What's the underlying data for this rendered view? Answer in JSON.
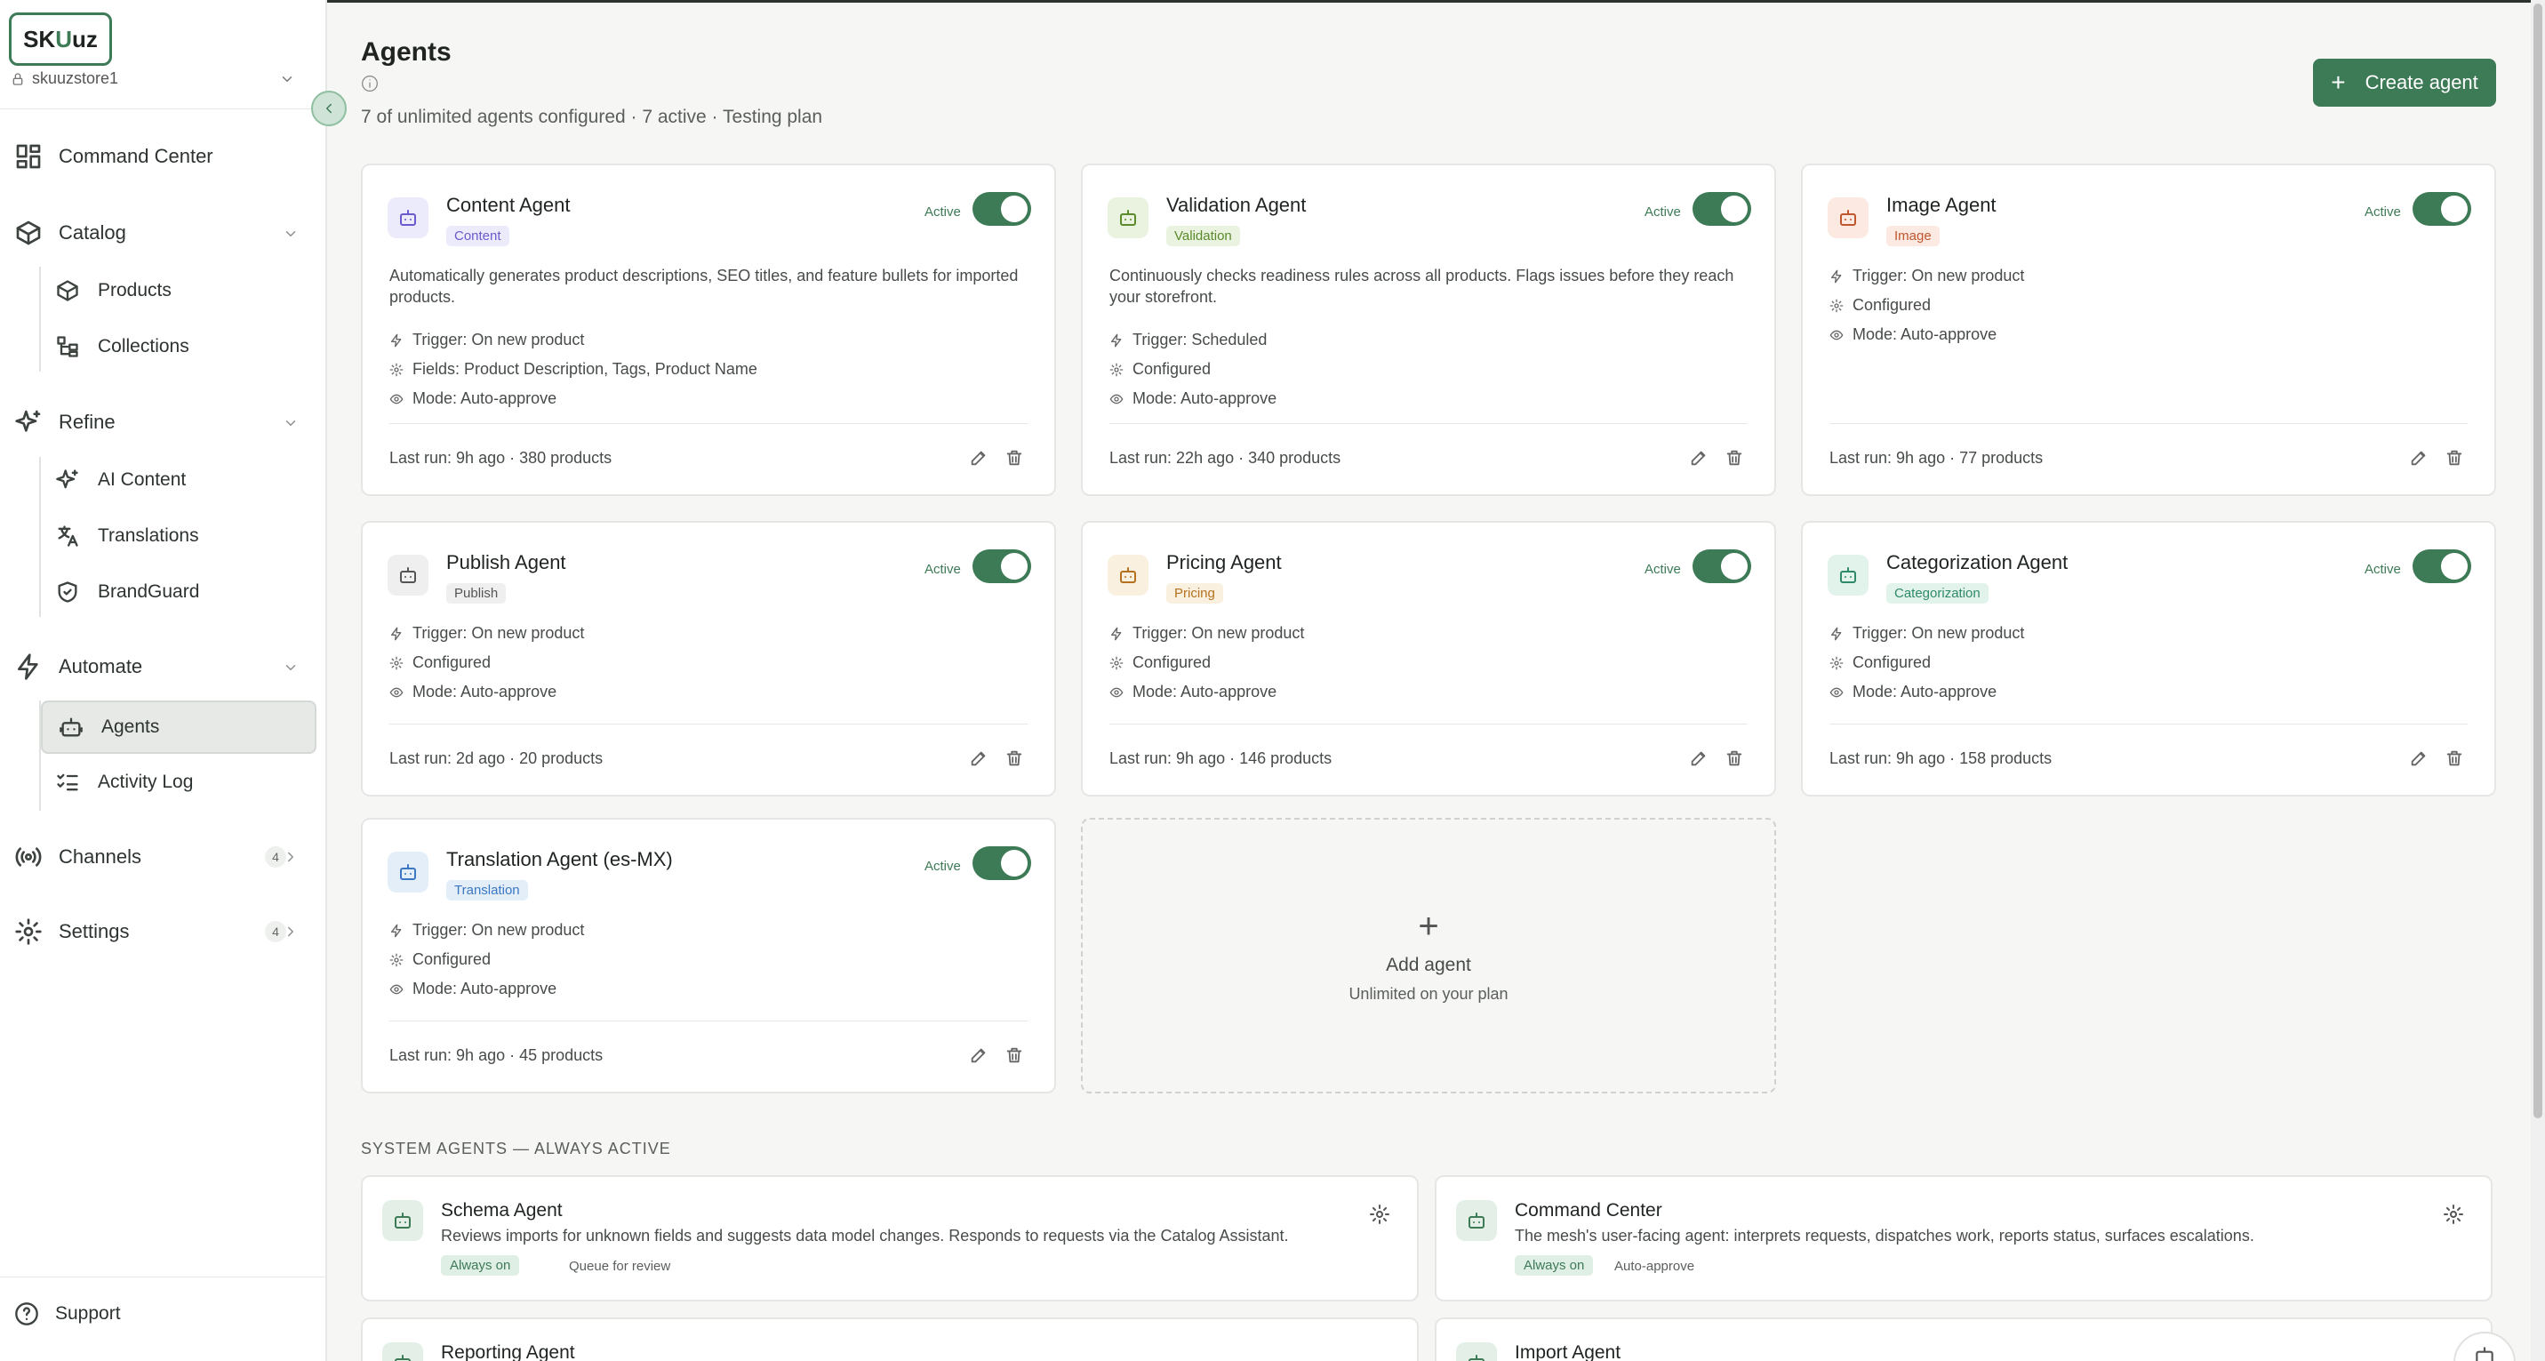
{
  "brand": {
    "logo_a": "SK",
    "logo_b": "U",
    "logo_c": "uz",
    "store": "skuuzstore1"
  },
  "nav": {
    "command_center": "Command Center",
    "catalog": "Catalog",
    "products": "Products",
    "collections": "Collections",
    "refine": "Refine",
    "ai_content": "AI Content",
    "translations": "Translations",
    "brandguard": "BrandGuard",
    "automate": "Automate",
    "agents": "Agents",
    "activity_log": "Activity Log",
    "channels": "Channels",
    "channels_count": "4",
    "settings": "Settings",
    "settings_count": "4",
    "support": "Support"
  },
  "header": {
    "title": "Agents",
    "subtitle": "7 of unlimited agents configured · 7 active · Testing plan",
    "create_label": "Create agent"
  },
  "agents": [
    {
      "name": "Content Agent",
      "tag": "Content",
      "status": "Active",
      "desc": "Automatically generates product descriptions, SEO titles, and feature bullets for imported products.",
      "trigger": "Trigger: On new product",
      "config": "Fields: Product Description, Tags, Product Name",
      "mode": "Mode: Auto-approve",
      "lastrun": "Last run: 9h ago · 380 products"
    },
    {
      "name": "Validation Agent",
      "tag": "Validation",
      "status": "Active",
      "desc": "Continuously checks readiness rules across all products. Flags issues before they reach your storefront.",
      "trigger": "Trigger: Scheduled",
      "config": "Configured",
      "mode": "Mode: Auto-approve",
      "lastrun": "Last run: 22h ago · 340 products"
    },
    {
      "name": "Image Agent",
      "tag": "Image",
      "status": "Active",
      "desc": "",
      "trigger": "Trigger: On new product",
      "config": "Configured",
      "mode": "Mode: Auto-approve",
      "lastrun": "Last run: 9h ago · 77 products"
    },
    {
      "name": "Publish Agent",
      "tag": "Publish",
      "status": "Active",
      "desc": "",
      "trigger": "Trigger: On new product",
      "config": "Configured",
      "mode": "Mode: Auto-approve",
      "lastrun": "Last run: 2d ago · 20 products"
    },
    {
      "name": "Pricing Agent",
      "tag": "Pricing",
      "status": "Active",
      "desc": "",
      "trigger": "Trigger: On new product",
      "config": "Configured",
      "mode": "Mode: Auto-approve",
      "lastrun": "Last run: 9h ago · 146 products"
    },
    {
      "name": "Categorization Agent",
      "tag": "Categorization",
      "status": "Active",
      "desc": "",
      "trigger": "Trigger: On new product",
      "config": "Configured",
      "mode": "Mode: Auto-approve",
      "lastrun": "Last run: 9h ago · 158 products"
    },
    {
      "name": "Translation Agent (es-MX)",
      "tag": "Translation",
      "status": "Active",
      "desc": "",
      "trigger": "Trigger: On new product",
      "config": "Configured",
      "mode": "Mode: Auto-approve",
      "lastrun": "Last run: 9h ago · 45 products"
    }
  ],
  "add_agent": {
    "plus": "+",
    "title": "Add agent",
    "sub": "Unlimited on your plan"
  },
  "system": {
    "label": "SYSTEM AGENTS — ALWAYS ACTIVE",
    "agents": [
      {
        "name": "Schema Agent",
        "desc": "Reviews imports for unknown fields and suggests data model changes. Responds to requests via the Catalog Assistant.",
        "badge": "Always on",
        "mode": "Queue for review"
      },
      {
        "name": "Command Center",
        "desc": "The mesh's user-facing agent: interprets requests, dispatches work, reports status, surfaces escalations.",
        "badge": "Always on",
        "mode": "Auto-approve"
      },
      {
        "name": "Reporting Agent"
      },
      {
        "name": "Import Agent"
      }
    ]
  },
  "colors": {
    "accent": "#3d7a56",
    "content": "#6a5acd",
    "validation": "#5a8a2a",
    "image": "#c0562e",
    "publish": "#666666",
    "pricing": "#b5711d",
    "categorization": "#2f8a6a",
    "translation": "#3b78c4"
  }
}
